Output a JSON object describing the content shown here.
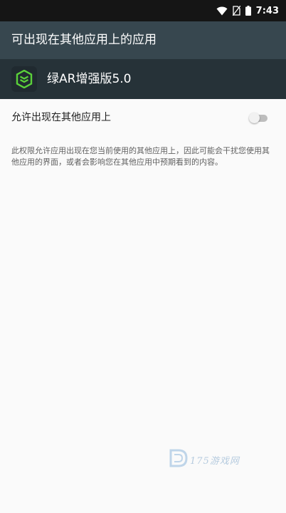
{
  "status_bar": {
    "time": "7:43",
    "icons": [
      "wifi-icon",
      "no-sim-icon",
      "battery-icon"
    ]
  },
  "app_bar": {
    "title": "可出现在其他应用上的应用"
  },
  "app_header": {
    "icon": "green-ar-app-icon",
    "name": "绿AR增强版5.0"
  },
  "setting": {
    "label": "允许出现在其他应用上",
    "enabled": false
  },
  "description": "此权限允许应用出现在您当前使用的其他应用上，因此可能会干扰您使用其他应用的界面，或者会影响您在其他应用中预期看到的内容。",
  "watermark": {
    "text": "175游戏网"
  },
  "colors": {
    "status_bar": "#151515",
    "app_bar": "#37474f",
    "app_header": "#263238",
    "background": "#fafafa",
    "app_icon_accent": "#5bd13a"
  }
}
